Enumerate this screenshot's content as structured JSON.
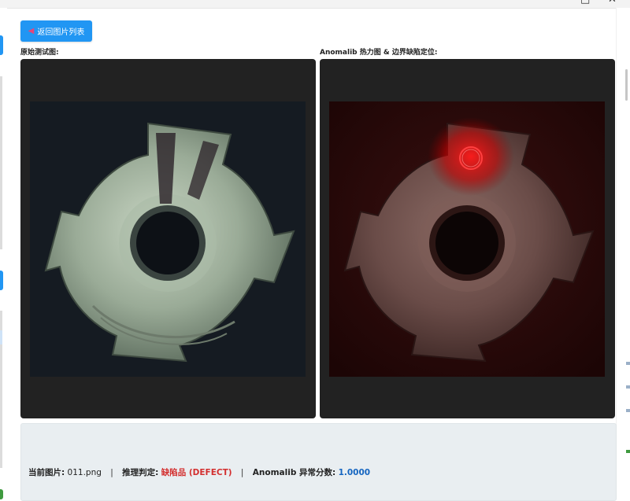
{
  "window": {
    "controls": [
      "□",
      "✕"
    ]
  },
  "toolbar": {
    "back_icon": "◀",
    "back_label": "返回图片列表"
  },
  "panels": {
    "original_label": "原始测试图:",
    "heatmap_label": "Anomalib 热力图 & 边界缺陷定位:"
  },
  "status": {
    "current_image_key": "当前图片:",
    "current_image_value": "011.png",
    "separator": "|",
    "verdict_key": "推理判定:",
    "verdict_value": "缺陷品 (DEFECT)",
    "score_key": "Anomalib 异常分数:",
    "score_value": "1.0000"
  },
  "colors": {
    "accent": "#2196f3",
    "defect": "#d32f2f",
    "score": "#1565c0",
    "panel_bg": "#222222"
  }
}
